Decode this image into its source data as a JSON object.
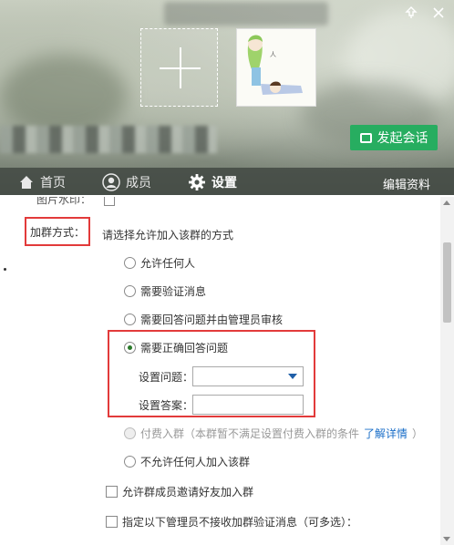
{
  "header": {
    "start_chat_label": "发起会话",
    "icons": [
      "pin-icon",
      "close-icon"
    ]
  },
  "tabs": {
    "home": "首页",
    "members": "成员",
    "settings": "设置"
  },
  "edit_profile_label": "编辑资料",
  "settings": {
    "cut_row_label": "图片水印：",
    "join_method_label": "加群方式：",
    "join_method_hint": "请选择允许加入该群的方式",
    "options": {
      "anyone": "允许任何人",
      "verify_message": "需要验证消息",
      "answer_and_admin": "需要回答问题并由管理员审核",
      "correct_answer": "需要正确回答问题",
      "paid_prefix": "付费入群（本群暂不满足设置付费入群的条件",
      "paid_link": "了解详情",
      "paid_suffix": "）",
      "no_one": "不允许任何人加入该群"
    },
    "selected_option": "correct_answer",
    "question_label": "设置问题：",
    "answer_label": "设置答案：",
    "question_value": "",
    "answer_value": "",
    "allow_invite_label": "允许群成员邀请好友加入群",
    "admin_no_receive_label": "指定以下管理员不接收加群验证消息（可多选）："
  },
  "colors": {
    "accent_green": "#27ad60",
    "highlight_red": "#e23a3a",
    "link_blue": "#1a6ec8"
  }
}
